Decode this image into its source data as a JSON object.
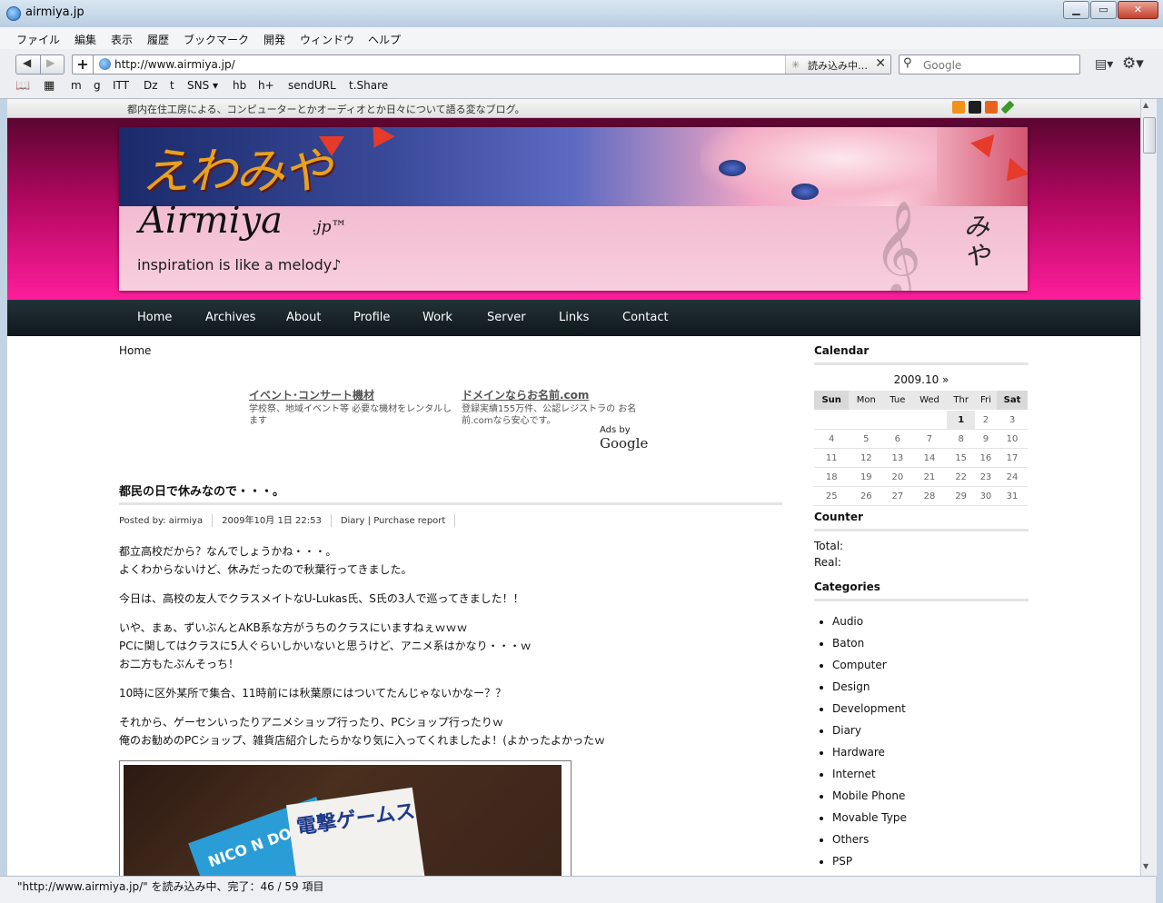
{
  "window": {
    "title": "airmiya.jp"
  },
  "menu": [
    "ファイル",
    "編集",
    "表示",
    "履歴",
    "ブックマーク",
    "開発",
    "ウィンドウ",
    "ヘルプ"
  ],
  "nav": {
    "url": "http://www.airmiya.jp/",
    "loading_label": "読み込み中…",
    "search_placeholder": "Google"
  },
  "bookmarks": [
    "m",
    "g",
    "ITT",
    "t",
    "Dz",
    "t",
    "SNS ▾",
    "hb",
    "h+",
    "sendURL",
    "t.Share"
  ],
  "status": "\"http://www.airmiya.jp/\" を読み込み中、完了：46 / 59 項目",
  "site": {
    "tagline": "都内在住工房による、コンピューターとかオーディオとか日々について語る変なブログ。",
    "banner_kana": "えわみや",
    "banner_logo": "Airmiya",
    "banner_logo_suffix": ".jp™",
    "banner_slogan": "inspiration is like a melody♪",
    "banner_miya": "みや",
    "nav": [
      "Home",
      "Archives",
      "About",
      "Profile",
      "Work",
      "Server",
      "Links",
      "Contact"
    ],
    "breadcrumb": "Home",
    "ads": [
      {
        "title": "イベント･コンサート機材",
        "desc": "学校祭、地域イベント等 必要な機材をレンタルします"
      },
      {
        "title": "ドメインならお名前.com",
        "desc": "登録実績155万件、公認レジストラの お名前.comなら安心です。"
      }
    ],
    "ads_by": "Ads by",
    "ads_brand": "Google"
  },
  "post": {
    "title": "都民の日で休みなので・・・。",
    "author": "Posted by: airmiya",
    "date": "2009年10月 1日 22:53",
    "categories": "Diary | Purchase report",
    "paragraphs": [
      [
        "都立高校だから？なんでしょうかね・・・。",
        "よくわからないけど、休みだったので秋葉行ってきました。"
      ],
      [
        "今日は、高校の友人でクラスメイトなU-Lukas氏、S氏の3人で巡ってきました！！"
      ],
      [
        "いや、まぁ、ずいぶんとAKB系な方がうちのクラスにいますねぇｗｗｗ",
        "PCに関してはクラスに5人ぐらいしかいないと思うけど、アニメ系はかなり・・・ｗ",
        "お二方もたぶんそっち！"
      ],
      [
        "10時に区外某所で集合、11時前には秋葉原にはついてたんじゃないかなー？？"
      ],
      [
        "それから、ゲーセンいったりアニメショップ行ったり、PCショップ行ったりｗ",
        "俺のお勧めのPCショップ、雑貨店紹介したらかなり気に入ってくれましたよ！(よかったよかったｗ"
      ]
    ],
    "photo_text_1": "NICO N DOU",
    "photo_text_2": "電撃ゲームス"
  },
  "sidebar": {
    "calendar_title": "Calendar",
    "calendar_month": "2009.10 »",
    "weekdays": [
      "Sun",
      "Mon",
      "Tue",
      "Wed",
      "Thr",
      "Fri",
      "Sat"
    ],
    "weeks": [
      [
        "",
        "",
        "",
        "",
        "1",
        "2",
        "3"
      ],
      [
        "4",
        "5",
        "6",
        "7",
        "8",
        "9",
        "10"
      ],
      [
        "11",
        "12",
        "13",
        "14",
        "15",
        "16",
        "17"
      ],
      [
        "18",
        "19",
        "20",
        "21",
        "22",
        "23",
        "24"
      ],
      [
        "25",
        "26",
        "27",
        "28",
        "29",
        "30",
        "31"
      ]
    ],
    "counter_title": "Counter",
    "counter_total": "Total:",
    "counter_real": "Real:",
    "categories_title": "Categories",
    "categories": [
      "Audio",
      "Baton",
      "Computer",
      "Design",
      "Development",
      "Diary",
      "Hardware",
      "Internet",
      "Mobile Phone",
      "Movable Type",
      "Others",
      "PSP"
    ]
  }
}
